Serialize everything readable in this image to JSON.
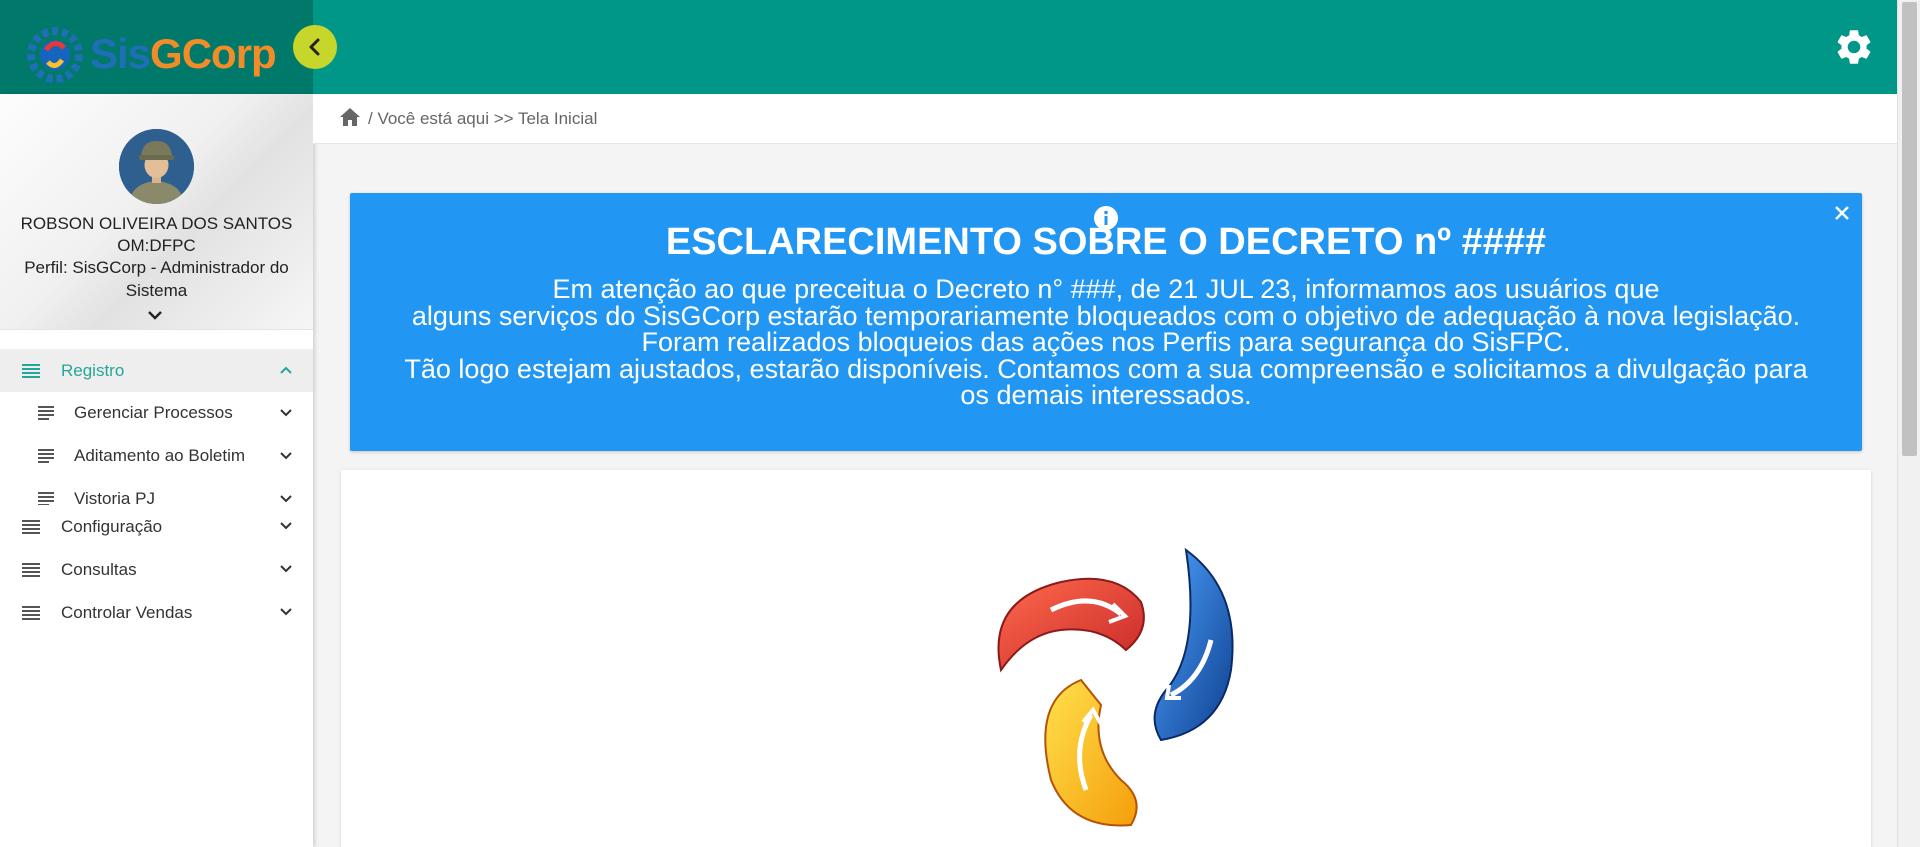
{
  "app": {
    "logo_text_a": "Sis",
    "logo_text_b": "GCorp"
  },
  "user": {
    "name": "ROBSON OLIVEIRA DOS SANTOS",
    "om": "OM:DFPC",
    "perfil": "Perfil: SisGCorp - Administrador do Sistema"
  },
  "sidebar": {
    "items": [
      {
        "label": "Registro",
        "active": true
      },
      {
        "label": "Configuração"
      },
      {
        "label": "Consultas"
      },
      {
        "label": "Controlar Vendas"
      }
    ],
    "subitems": [
      {
        "label": "Gerenciar Processos"
      },
      {
        "label": "Aditamento ao Boletim"
      },
      {
        "label": "Vistoria PJ"
      }
    ]
  },
  "breadcrumb": {
    "text": "/ Você está aqui >> Tela Inicial"
  },
  "alert": {
    "title": "ESCLARECIMENTO SOBRE O DECRETO nº ####",
    "line1": "Em atenção ao que preceitua o Decreto n° ###, de 21 JUL 23, informamos aos usuários que",
    "line2": "alguns serviços do SisGCorp estarão temporariamente bloqueados com o objetivo de adequação à nova legislação.",
    "line3": "Foram realizados bloqueios das ações nos Perfis para segurança do SisFPC.",
    "line4": "Tão logo estejam ajustados, estarão disponíveis. Contamos com a sua compreensão e solicitamos a divulgação para os demais interessados.",
    "color": "#2196f3"
  },
  "colors": {
    "topbar": "#009688",
    "accent": "#26a69a",
    "collapse_button": "#c6d62a"
  },
  "icons": {
    "settings": "gear-icon",
    "home": "home-icon",
    "info": "info-icon",
    "close": "close-icon",
    "collapse": "chevron-left-icon"
  }
}
